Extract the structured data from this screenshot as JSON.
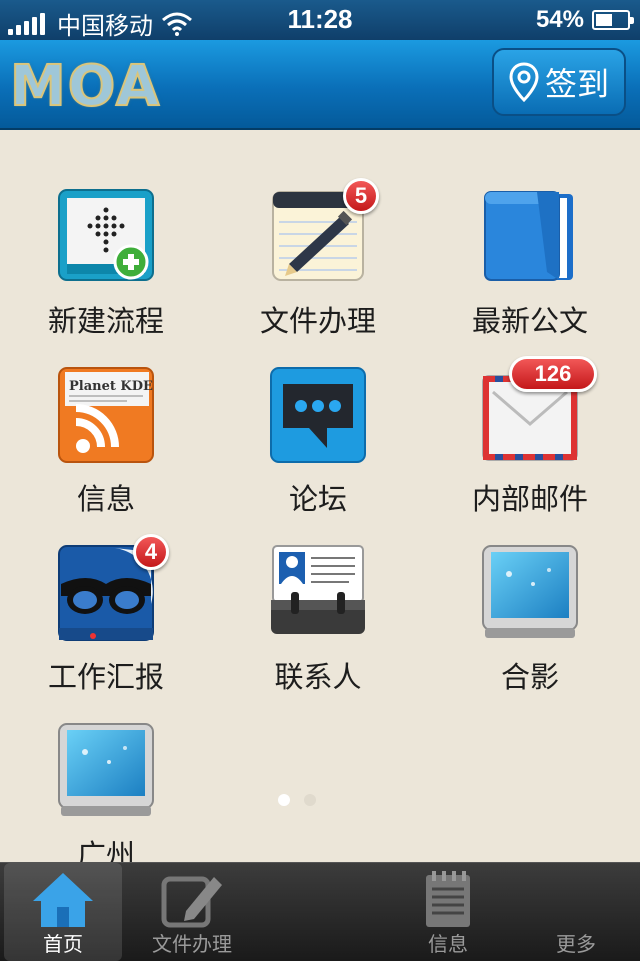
{
  "status": {
    "carrier": "中国移动",
    "time": "11:28",
    "battery": "54%",
    "battery_level": 0.54
  },
  "header": {
    "logo": "MOA",
    "checkin_label": "签到"
  },
  "grid": [
    {
      "label": "新建流程",
      "icon": "new-process-icon",
      "badge": ""
    },
    {
      "label": "文件办理",
      "icon": "document-handling-icon",
      "badge": "5"
    },
    {
      "label": "最新公文",
      "icon": "latest-documents-icon",
      "badge": ""
    },
    {
      "label": "信息",
      "icon": "rss-icon",
      "badge": ""
    },
    {
      "label": "论坛",
      "icon": "forum-icon",
      "badge": ""
    },
    {
      "label": "内部邮件",
      "icon": "mail-icon",
      "badge": "126"
    },
    {
      "label": "工作汇报",
      "icon": "work-report-icon",
      "badge": "4"
    },
    {
      "label": "联系人",
      "icon": "contacts-icon",
      "badge": ""
    },
    {
      "label": "合影",
      "icon": "photo-icon",
      "badge": ""
    },
    {
      "label": "广州",
      "icon": "photo-icon",
      "badge": ""
    }
  ],
  "page_dots": {
    "count": 2,
    "active": 1
  },
  "tabs": [
    {
      "label": "首页",
      "icon": "home-icon",
      "active": true
    },
    {
      "label": "文件办理",
      "icon": "edit-icon",
      "active": false
    },
    {
      "label": "信息",
      "icon": "notepad-icon",
      "active": false
    },
    {
      "label": "更多",
      "icon": "more-icon",
      "active": false
    }
  ],
  "colors": {
    "header_blue": "#0a6fb8",
    "background": "#ece6d9",
    "badge_red": "#d42a2a",
    "tabbar": "#2a2a2a"
  },
  "rss_panel_text": "Planet KDE"
}
